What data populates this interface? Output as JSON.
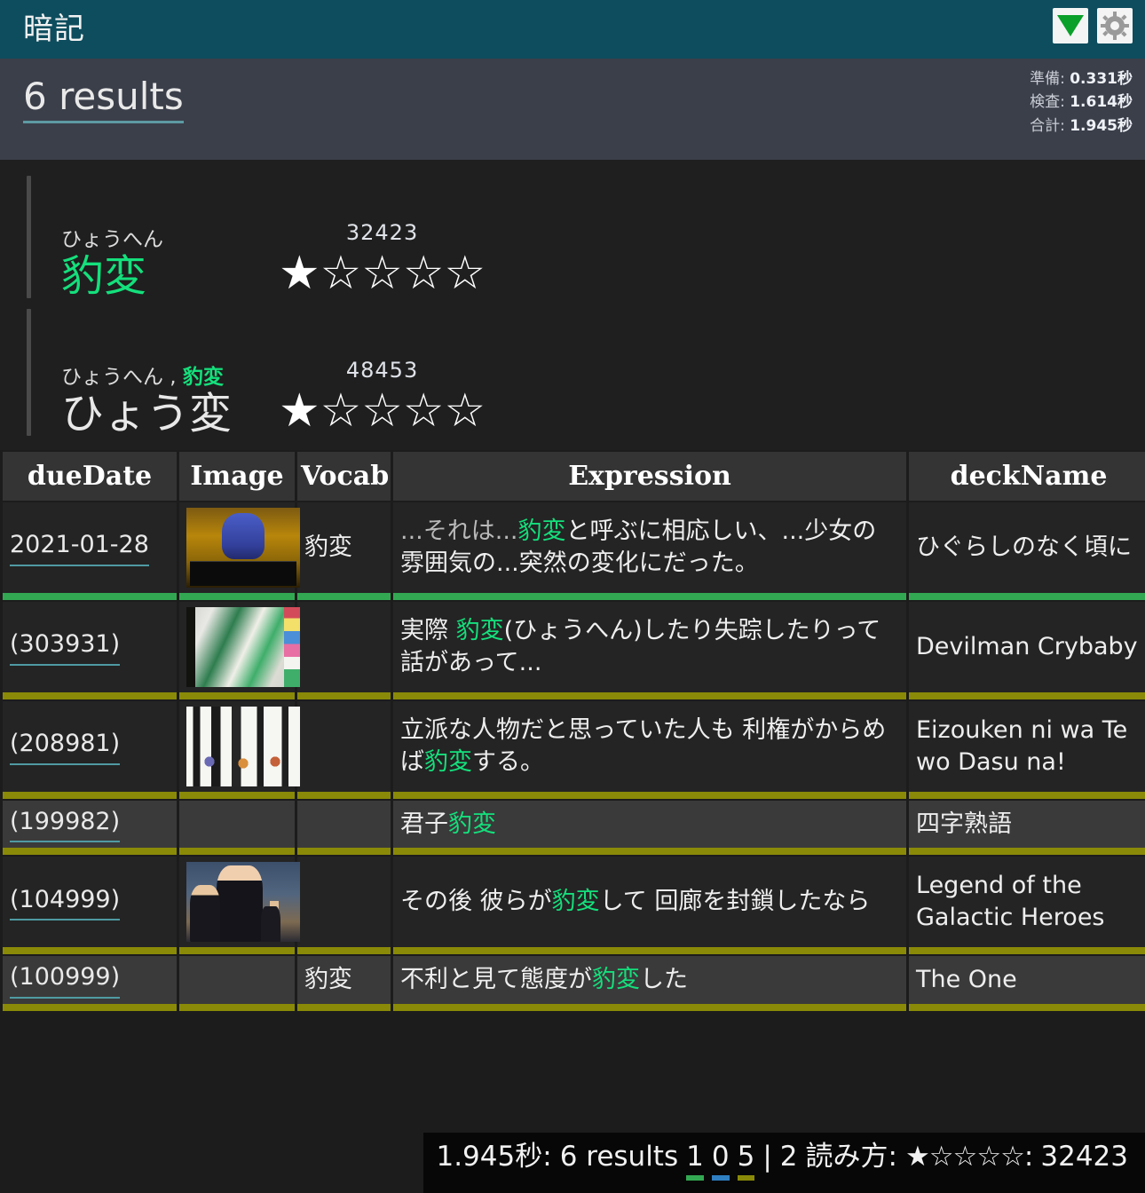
{
  "header": {
    "title": "暗記",
    "icons": [
      {
        "name": "download-icon",
        "glyph": "▼"
      },
      {
        "name": "gear-icon",
        "glyph": "⚙"
      }
    ]
  },
  "stats": {
    "results_title": "6 results",
    "timings": [
      {
        "label": "準備:",
        "value": "0.331秒"
      },
      {
        "label": "検査:",
        "value": "1.614秒"
      },
      {
        "label": "合計:",
        "value": "1.945秒"
      }
    ]
  },
  "entries": [
    {
      "furigana": "ひょうへん",
      "furigana_sep": "",
      "furigana_kanji": "",
      "word": "豹変",
      "word_color": "green",
      "count": "32423",
      "stars": "★☆☆☆☆",
      "star_filled": 1,
      "star_total": 5
    },
    {
      "furigana": "ひょうへん",
      "furigana_sep": " , ",
      "furigana_kanji": "豹変",
      "word": "ひょう変",
      "word_color": "white",
      "count": "48453",
      "stars": "★☆☆☆☆",
      "star_filled": 1,
      "star_total": 5
    }
  ],
  "table": {
    "columns": [
      "dueDate",
      "Image",
      "Vocab",
      "Expression",
      "deckName"
    ],
    "rows": [
      {
        "dueDate": "2021-01-28",
        "image": "higurashi-thumbnail",
        "vocab": "豹変",
        "expression_pre": "...それは...",
        "expression_kw": "豹変",
        "expression_post": "と呼ぶに相応しい、...少女の雰囲気の...突然の変化にだった。",
        "deckName": "ひぐらしのなく頃に",
        "mark": "green",
        "shade": "dark"
      },
      {
        "dueDate": "(303931)",
        "image": "devilman-thumbnail",
        "vocab": "",
        "expression_pre": "実際 ",
        "expression_kw": "豹変",
        "expression_post": "(ひょうへん)したり失踪したりって 話があって...",
        "deckName": "Devilman Crybaby",
        "mark": "olive",
        "shade": "dark"
      },
      {
        "dueDate": "(208981)",
        "image": "eizouken-thumbnail",
        "vocab": "",
        "expression_pre": "立派な人物だと思っていた人も 利権がからめば",
        "expression_kw": "豹変",
        "expression_post": "する。",
        "deckName": "Eizouken ni wa Te wo Dasu na!",
        "mark": "olive",
        "shade": "dark"
      },
      {
        "dueDate": "(199982)",
        "image": "",
        "vocab": "",
        "expression_pre": "君子",
        "expression_kw": "豹変",
        "expression_post": "",
        "deckName": "四字熟語",
        "mark": "olive",
        "shade": "light"
      },
      {
        "dueDate": "(104999)",
        "image": "logh-thumbnail",
        "vocab": "",
        "expression_pre": "その後 彼らが",
        "expression_kw": "豹変",
        "expression_post": "して 回廊を封鎖したなら",
        "deckName": "Legend of the Galactic Heroes",
        "mark": "olive",
        "shade": "dark"
      },
      {
        "dueDate": "(100999)",
        "image": "",
        "vocab": "豹変",
        "expression_pre": "不利と見て態度が",
        "expression_kw": "豹変",
        "expression_post": "した",
        "deckName": "The One",
        "mark": "olive",
        "shade": "light"
      }
    ]
  },
  "footer": {
    "time": "1.945秒:",
    "results": "6 results",
    "count_green": "1",
    "count_blue": "0",
    "count_olive": "5",
    "divider": "|",
    "reading_count": "2",
    "reading_label": "読み方:",
    "stars": "★☆☆☆☆:",
    "total": "32423"
  },
  "colors": {
    "header_bg": "#0e4d5e",
    "accent_green": "#14e07c",
    "mark_green": "#33a852",
    "mark_olive": "#8a8a08",
    "mark_blue": "#2f7fc1",
    "underline_teal": "#4f9aa3"
  }
}
